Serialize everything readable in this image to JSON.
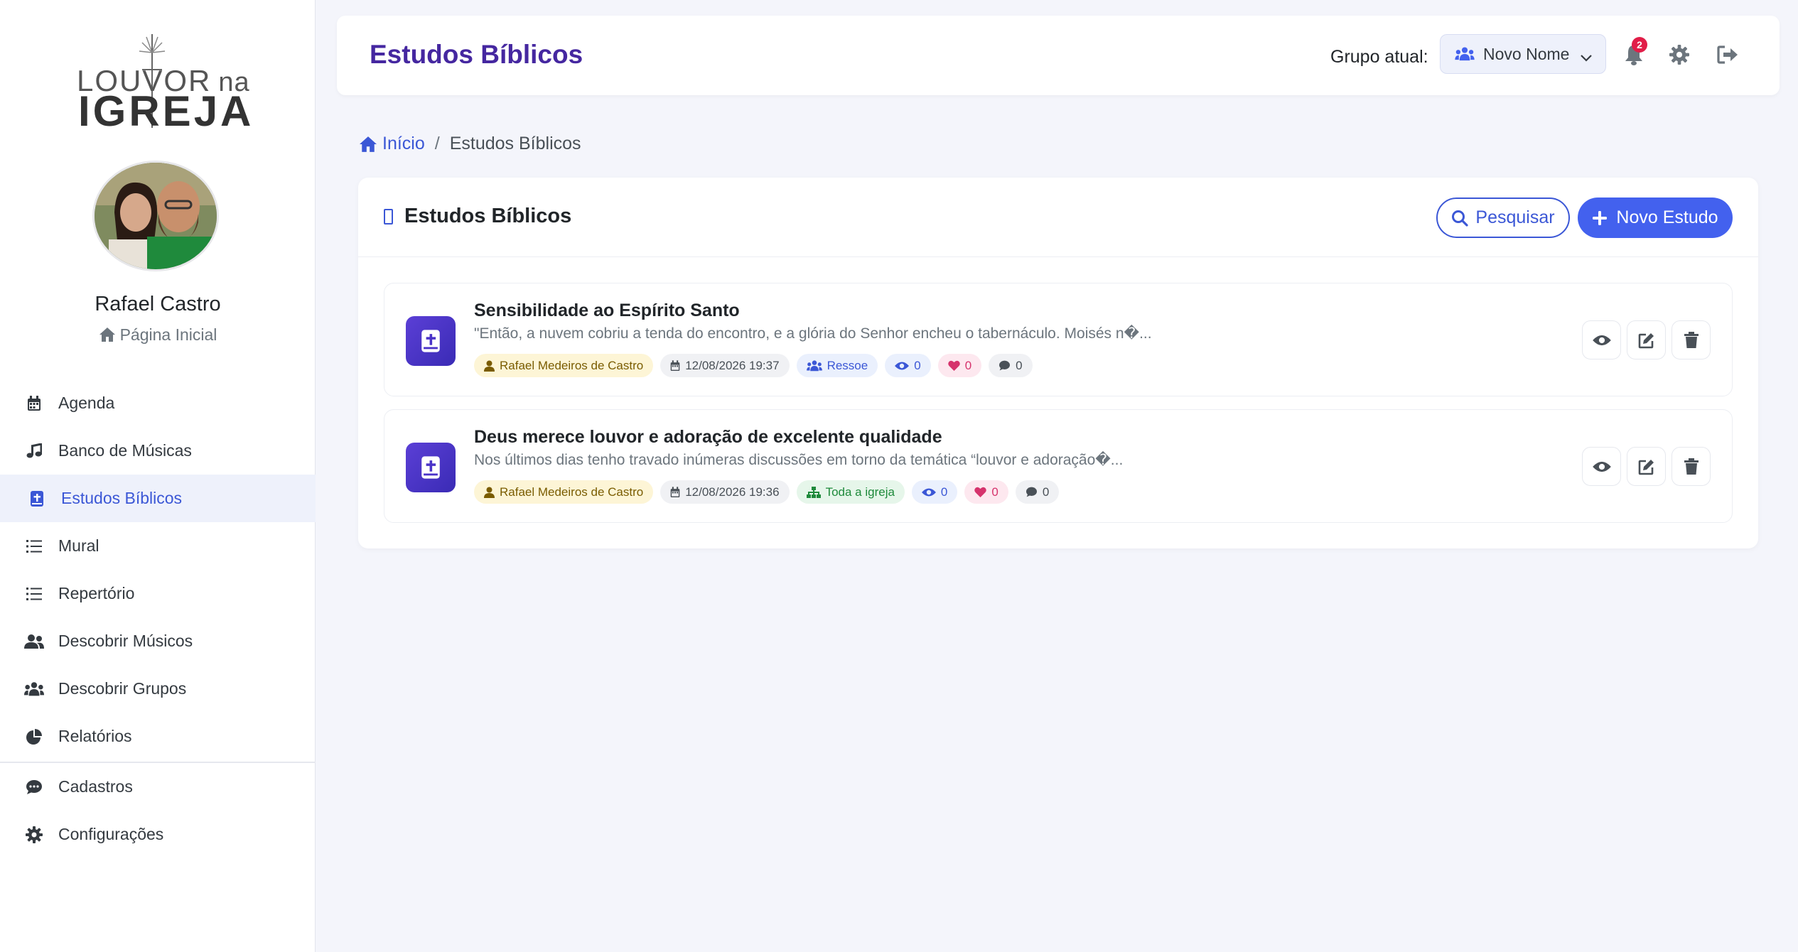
{
  "brand": {
    "logo_line1": "LOUVOR",
    "logo_na": "na",
    "logo_line2": "IGREJA"
  },
  "user": {
    "name": "Rafael Castro",
    "home_link": "Página Inicial"
  },
  "sidebar": {
    "items": [
      {
        "label": "Agenda",
        "icon": "calendar-icon"
      },
      {
        "label": "Banco de Músicas",
        "icon": "music-icon"
      },
      {
        "label": "Estudos Bíblicos",
        "icon": "bible-icon",
        "active": true
      },
      {
        "label": "Mural",
        "icon": "list-icon"
      },
      {
        "label": "Repertório",
        "icon": "list-icon"
      },
      {
        "label": "Descobrir Músicos",
        "icon": "users-icon"
      },
      {
        "label": "Descobrir Grupos",
        "icon": "users-group-icon"
      },
      {
        "label": "Relatórios",
        "icon": "pie-chart-icon"
      }
    ],
    "bottom_items": [
      {
        "label": "Cadastros",
        "icon": "comment-icon"
      },
      {
        "label": "Configurações",
        "icon": "gear-icon"
      }
    ]
  },
  "header": {
    "title": "Estudos Bíblicos",
    "group_label": "Grupo atual:",
    "group_value": "Novo Nome",
    "notifications_count": "2"
  },
  "breadcrumb": {
    "home": "Início",
    "separator": "/",
    "current": "Estudos Bíblicos"
  },
  "card": {
    "title": "Estudos Bíblicos",
    "search_label": "Pesquisar",
    "new_label": "Novo Estudo"
  },
  "studies": [
    {
      "title": "Sensibilidade ao Espírito Santo",
      "excerpt": "\"Então, a nuvem cobriu a tenda do encontro, e a glória do Senhor encheu o tabernáculo. Moisés n�...",
      "author": "Rafael Medeiros de Castro",
      "date": "12/08/2026 19:37",
      "audience": "Ressoe",
      "audience_type": "group",
      "views": "0",
      "likes": "0",
      "comments": "0"
    },
    {
      "title": "Deus merece louvor e adoração de excelente qualidade",
      "excerpt": "Nos últimos dias tenho travado inúmeras discussões em torno da temática “louvor e adoração�...",
      "author": "Rafael Medeiros de Castro",
      "date": "12/08/2026 19:36",
      "audience": "Toda a igreja",
      "audience_type": "church",
      "views": "0",
      "likes": "0",
      "comments": "0"
    }
  ],
  "colors": {
    "accent": "#4361ee",
    "title": "#4527a0",
    "badge": "#e11d48"
  }
}
